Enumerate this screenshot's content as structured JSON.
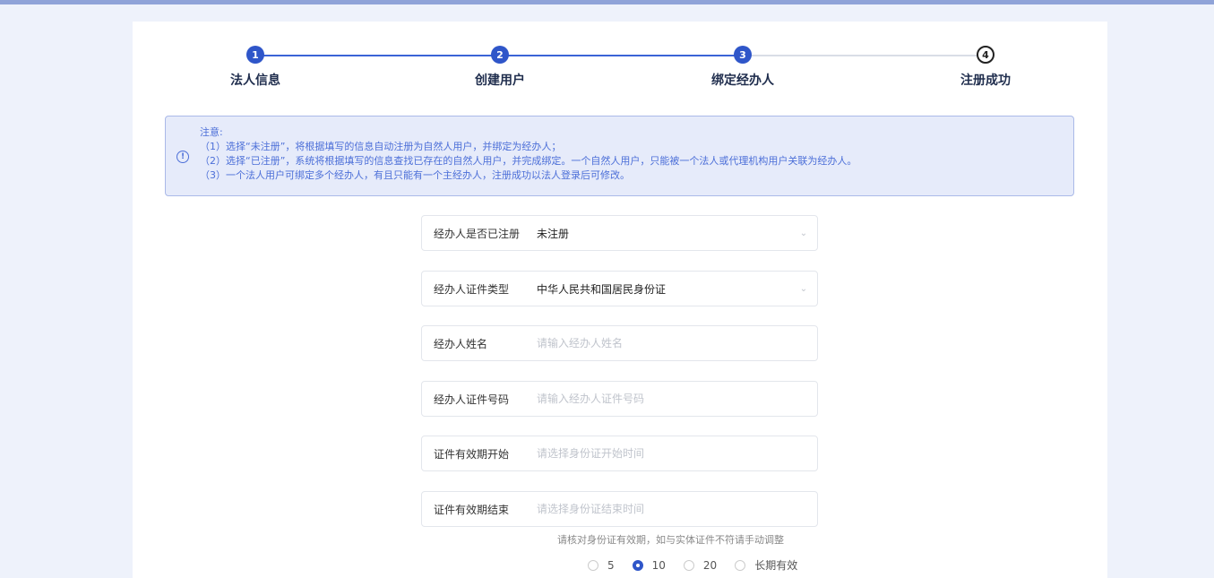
{
  "steps": [
    {
      "num": "1",
      "label": "法人信息"
    },
    {
      "num": "2",
      "label": "创建用户"
    },
    {
      "num": "3",
      "label": "绑定经办人"
    },
    {
      "num": "4",
      "label": "注册成功"
    }
  ],
  "notice": {
    "title": "注意:",
    "lines": [
      "（1）选择“未注册”，将根据填写的信息自动注册为自然人用户，并绑定为经办人；",
      "（2）选择“已注册”，系统将根据填写的信息查找已存在的自然人用户，并完成绑定。一个自然人用户，只能被一个法人或代理机构用户关联为经办人。",
      "（3）一个法人用户可绑定多个经办人，有且只能有一个主经办人，注册成功以法人登录后可修改。"
    ]
  },
  "form": {
    "registered": {
      "label": "经办人是否已注册",
      "value": "未注册"
    },
    "id_type": {
      "label": "经办人证件类型",
      "value": "中华人民共和国居民身份证"
    },
    "name": {
      "label": "经办人姓名",
      "placeholder": "请输入经办人姓名"
    },
    "id_number": {
      "label": "经办人证件号码",
      "placeholder": "请输入经办人证件号码"
    },
    "valid_start": {
      "label": "证件有效期开始",
      "placeholder": "请选择身份证开始时间"
    },
    "valid_end": {
      "label": "证件有效期结束",
      "placeholder": "请选择身份证结束时间"
    }
  },
  "hint": "请核对身份证有效期，如与实体证件不符请手动调整",
  "validity_options": [
    {
      "label": "5",
      "selected": false
    },
    {
      "label": "10",
      "selected": true
    },
    {
      "label": "20",
      "selected": false
    },
    {
      "label": "长期有效",
      "selected": false
    }
  ],
  "colors": {
    "accent": "#2f56c9",
    "notice_bg": "#e6ebfa",
    "notice_text": "#4c6fd8"
  }
}
